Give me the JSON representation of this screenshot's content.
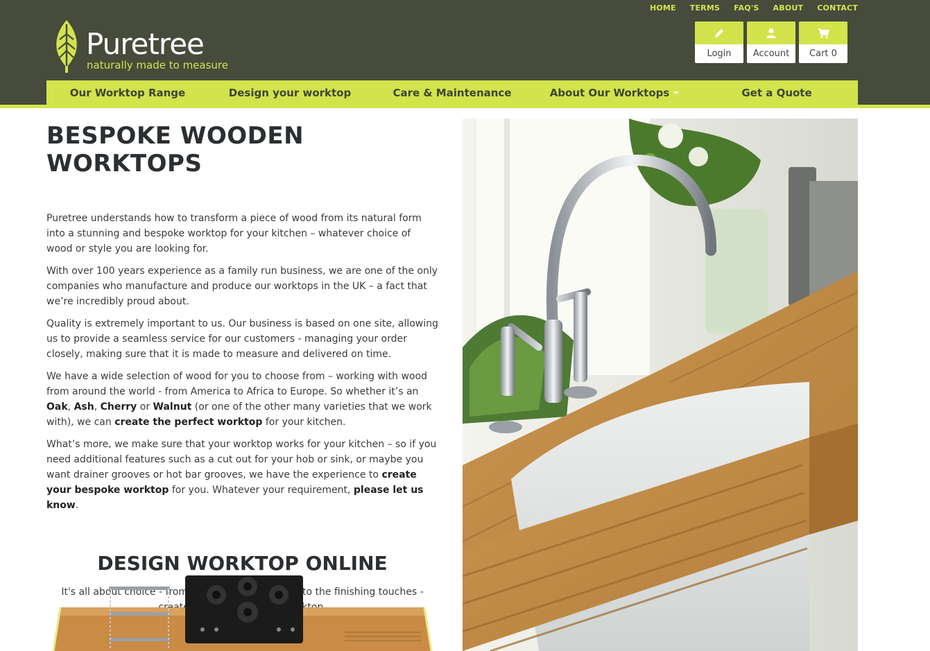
{
  "top_links": [
    "HOME",
    "TERMS",
    "FAQ'S",
    "ABOUT",
    "CONTACT"
  ],
  "logo": {
    "name": "Puretree",
    "tagline": "naturally made to measure"
  },
  "user_buttons": [
    {
      "label": "Login",
      "icon": "pencil-icon"
    },
    {
      "label": "Account",
      "icon": "user-icon"
    },
    {
      "label": "Cart 0",
      "icon": "cart-icon"
    }
  ],
  "nav": [
    "Our Worktop Range",
    "Design your worktop",
    "Care & Maintenance",
    "About Our Worktops",
    "Get a Quote"
  ],
  "main": {
    "title": "BESPOKE WOODEN WORKTOPS",
    "p1": "Puretree understands how to transform a piece of wood from its natural form into a stunning and bespoke worktop for your kitchen – whatever choice of wood or style you are looking for.",
    "p2": " With over 100 years experience as a family run business, we are one of the only companies who manufacture and produce our worktops in the UK – a fact that we’re incredibly proud about.",
    "p3": " Quality is extremely important to us. Our business is based on one site, allowing us to provide a seamless service for our customers - managing your order closely, making sure that it is made to measure and delivered on time.",
    "p4": {
      "a": " We have a wide selection of wood for you to choose from – working with wood from around the world - from America to Africa to Europe. So whether it’s an ",
      "oak": "Oak",
      "comma": ", ",
      "ash": "Ash",
      "comma2": ", ",
      "cherry": "Cherry",
      "or": " or ",
      "walnut": "Walnut",
      "b": " (or one of the other many varieties that we work with), we can ",
      "perfect": "create the perfect worktop",
      "c": " for your kitchen."
    },
    "p5": {
      "a": " What’s more, we make sure that your worktop works for your kitchen – so if you need additional features such as a cut out for your hob or sink, or maybe you want drainer grooves or hot bar grooves, we have the experience to ",
      "bespoke": "create your bespoke worktop",
      "b": " for you. Whatever your requirement, ",
      "know": "please let us know",
      "c": "."
    },
    "design_title": "DESIGN WORKTOP ONLINE",
    "design_sub": "It's all about choice - from the wood to the grade to the finishing touches - create your own bespoke worktop."
  },
  "colors": {
    "header_bg": "#464b3c",
    "accent": "#d3e34c",
    "heading": "#2b2f31"
  }
}
